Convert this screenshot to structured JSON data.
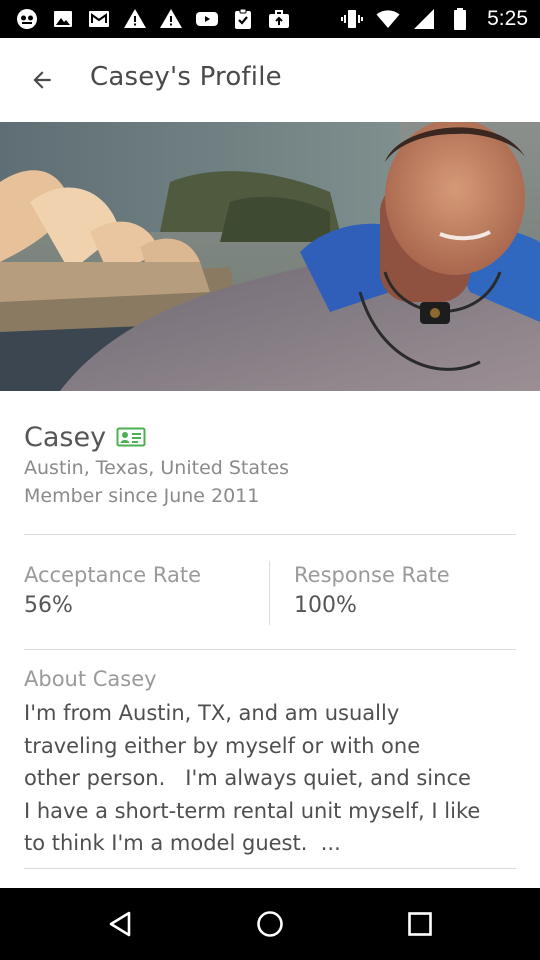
{
  "status_bar": {
    "time": "5:25",
    "icons": [
      "app-icon",
      "image-icon",
      "mail-icon",
      "warning-icon",
      "warning-icon",
      "youtube-icon",
      "clipboard-check-icon",
      "briefcase-upload-icon",
      "vibrate-icon",
      "wifi-icon",
      "signal-icon",
      "battery-icon"
    ]
  },
  "app_bar": {
    "title": "Casey's Profile",
    "back_icon": "arrow-back-icon"
  },
  "profile": {
    "name": "Casey",
    "verified_icon": "id-card-icon",
    "location": "Austin, Texas, United States",
    "member_since": "Member since June 2011"
  },
  "stats": {
    "acceptance_label": "Acceptance Rate",
    "acceptance_value": "56%",
    "response_label": "Response Rate",
    "response_value": "100%"
  },
  "about": {
    "title": "About Casey",
    "text": "I'm from Austin, TX, and am usually\ntraveling either by myself or with one\nother person.   I'm always quiet, and since\nI have a short-term rental unit myself, I like\nto think I'm a model guest.  ..."
  },
  "nav_bar": {
    "icons": [
      "back-triangle-icon",
      "home-circle-icon",
      "recents-square-icon"
    ]
  },
  "colors": {
    "status_bar": "#000000",
    "verified_green": "#4caf50",
    "text_dark": "#565656",
    "text_light": "#9a9a9a"
  }
}
